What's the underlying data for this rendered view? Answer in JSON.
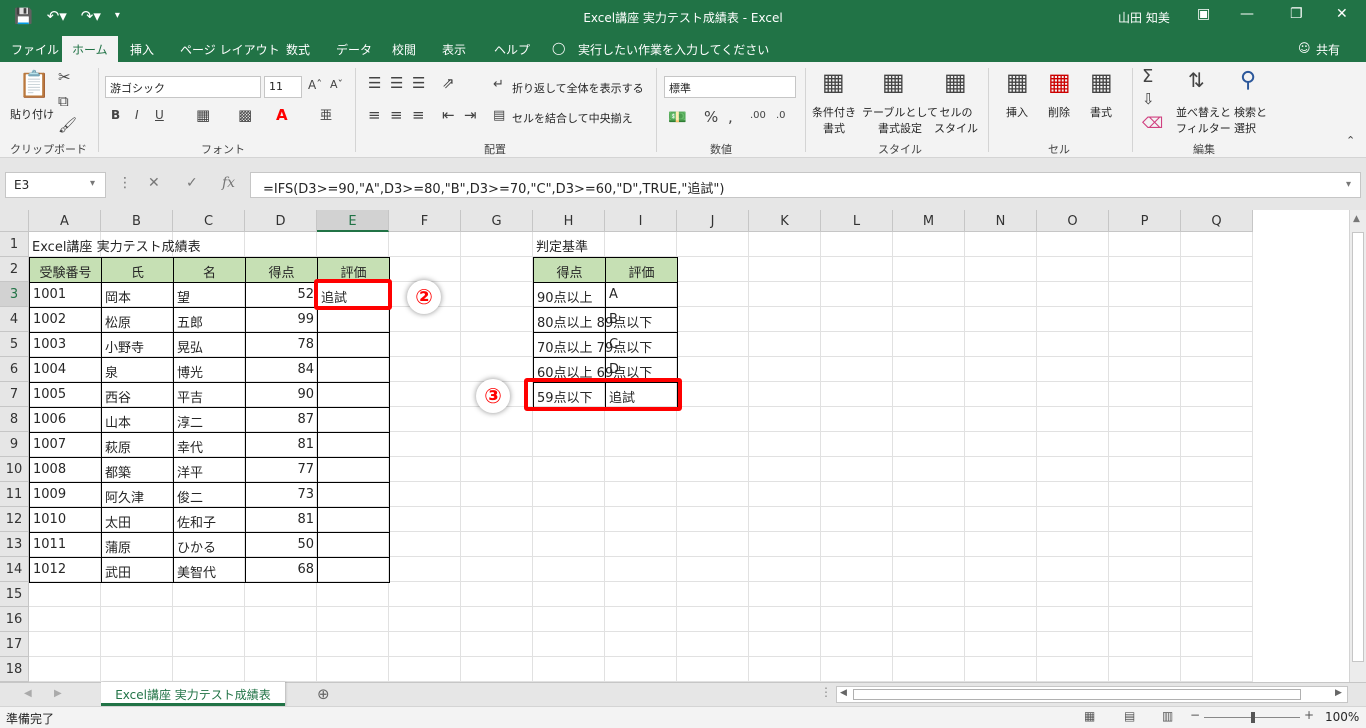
{
  "titlebar": {
    "title": "Excel講座 実力テスト成績表 - Excel",
    "user": "山田 知美",
    "icons": [
      "save-icon",
      "undo-icon",
      "redo-icon",
      "customize-qat-icon"
    ]
  },
  "tabs": [
    "ファイル",
    "ホーム",
    "挿入",
    "ページ レイアウト",
    "数式",
    "データ",
    "校閲",
    "表示",
    "ヘルプ"
  ],
  "tell_me": "実行したい作業を入力してください",
  "share": "共有",
  "ribbon": {
    "clipboard": {
      "paste": "貼り付け",
      "label": "クリップボード"
    },
    "font": {
      "name": "游ゴシック",
      "size": "11",
      "label": "フォント"
    },
    "alignment": {
      "wrap": "折り返して全体を表示する",
      "merge": "セルを結合して中央揃え",
      "label": "配置"
    },
    "number": {
      "format": "標準",
      "label": "数値"
    },
    "styles": {
      "conditional": "条件付き\n書式",
      "table": "テーブルとして\n書式設定",
      "cellstyle": "セルの\nスタイル",
      "label": "スタイル"
    },
    "cells": {
      "insert": "挿入",
      "delete": "削除",
      "format": "書式",
      "label": "セル"
    },
    "editing": {
      "sort": "並べ替えと\nフィルター",
      "find": "検索と\n選択",
      "label": "編集"
    }
  },
  "formula_bar": {
    "name_box": "E3",
    "formula": "=IFS(D3>=90,\"A\",D3>=80,\"B\",D3>=70,\"C\",D3>=60,\"D\",TRUE,\"追試\")"
  },
  "sheet": {
    "columns": [
      "A",
      "B",
      "C",
      "D",
      "E",
      "F",
      "G",
      "H",
      "I",
      "J",
      "K",
      "L",
      "M",
      "N",
      "O",
      "P",
      "Q"
    ],
    "rows": [
      "1",
      "2",
      "3",
      "4",
      "5",
      "6",
      "7",
      "8",
      "9",
      "10",
      "11",
      "12",
      "13",
      "14",
      "15",
      "16",
      "17",
      "18"
    ],
    "title": "Excel講座 実力テスト成績表",
    "headers": [
      "受験番号",
      "氏",
      "名",
      "得点",
      "評価"
    ],
    "students": [
      [
        "1001",
        "岡本",
        "望",
        "52",
        "追試"
      ],
      [
        "1002",
        "松原",
        "五郎",
        "99",
        ""
      ],
      [
        "1003",
        "小野寺",
        "晃弘",
        "78",
        ""
      ],
      [
        "1004",
        "泉",
        "博光",
        "84",
        ""
      ],
      [
        "1005",
        "西谷",
        "平吉",
        "90",
        ""
      ],
      [
        "1006",
        "山本",
        "淳二",
        "87",
        ""
      ],
      [
        "1007",
        "萩原",
        "幸代",
        "81",
        ""
      ],
      [
        "1008",
        "都築",
        "洋平",
        "77",
        ""
      ],
      [
        "1009",
        "阿久津",
        "俊二",
        "73",
        ""
      ],
      [
        "1010",
        "太田",
        "佐和子",
        "81",
        ""
      ],
      [
        "1011",
        "蒲原",
        "ひかる",
        "50",
        ""
      ],
      [
        "1012",
        "武田",
        "美智代",
        "68",
        ""
      ]
    ],
    "criteria_title": "判定基準",
    "criteria_headers": [
      "得点",
      "評価"
    ],
    "criteria": [
      [
        "90点以上",
        "A"
      ],
      [
        "80点以上 89点以下",
        "B"
      ],
      [
        "70点以上 79点以下",
        "C"
      ],
      [
        "60点以上 69点以下",
        "D"
      ],
      [
        "59点以下",
        "追試"
      ]
    ],
    "annotations": [
      "②",
      "③"
    ],
    "highlight_color": "#ff0000",
    "header_fill": "#c6e0b4"
  },
  "sheet_tab": "Excel講座 実力テスト成績表",
  "status": {
    "ready": "準備完了",
    "zoom": "100%"
  },
  "colors": {
    "accent": "#217346"
  }
}
